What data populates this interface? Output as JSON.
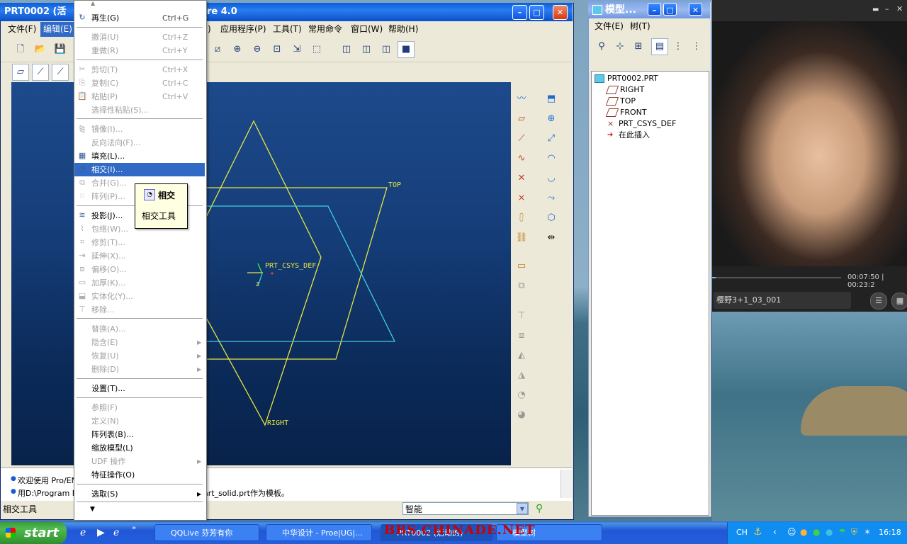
{
  "main_window": {
    "title": "PRT0002 (活",
    "title_suffix": "re 4.0",
    "menus": [
      "文件(F)",
      "编辑(E)",
      "应用程序(P)",
      "工具(T)",
      "常用命令",
      "窗口(W)",
      "帮助(H)"
    ],
    "menu_partial": ")"
  },
  "viewport": {
    "labels": {
      "top": "TOP",
      "right": "RIGHT",
      "csys": "PRT_CSYS_DEF",
      "z": "Z"
    }
  },
  "edit_menu": {
    "items": [
      {
        "label": "再生(G)",
        "shortcut": "Ctrl+G",
        "disabled": false,
        "icon": "regenerate-icon"
      },
      {
        "label": "撤消(U)",
        "shortcut": "Ctrl+Z",
        "disabled": true
      },
      {
        "label": "重做(R)",
        "shortcut": "Ctrl+Y",
        "disabled": true
      },
      {
        "label": "剪切(T)",
        "shortcut": "Ctrl+X",
        "disabled": true,
        "icon": "cut-icon"
      },
      {
        "label": "复制(C)",
        "shortcut": "Ctrl+C",
        "disabled": true,
        "icon": "copy-icon"
      },
      {
        "label": "粘贴(P)",
        "shortcut": "Ctrl+V",
        "disabled": true,
        "icon": "paste-icon"
      },
      {
        "label": "选择性粘贴(S)...",
        "shortcut": "",
        "disabled": true
      },
      {
        "label": "镜像(I)...",
        "shortcut": "",
        "disabled": true,
        "icon": "mirror-icon"
      },
      {
        "label": "反向法向(F)...",
        "shortcut": "",
        "disabled": true
      },
      {
        "label": "填充(L)...",
        "shortcut": "",
        "disabled": false,
        "icon": "fill-icon"
      },
      {
        "label": "相交(I)...",
        "shortcut": "",
        "disabled": false,
        "highlighted": true,
        "icon": "intersect-icon"
      },
      {
        "label": "合并(G)...",
        "shortcut": "",
        "disabled": true,
        "icon": "merge-icon"
      },
      {
        "label": "阵列(P)...",
        "shortcut": "",
        "disabled": true,
        "icon": "pattern-icon"
      },
      {
        "label": "投影(J)...",
        "shortcut": "",
        "disabled": false,
        "icon": "project-icon"
      },
      {
        "label": "包络(W)...",
        "shortcut": "",
        "disabled": true,
        "icon": "wrap-icon"
      },
      {
        "label": "修剪(T)...",
        "shortcut": "",
        "disabled": true,
        "icon": "trim-icon"
      },
      {
        "label": "延伸(X)...",
        "shortcut": "",
        "disabled": true,
        "icon": "extend-icon"
      },
      {
        "label": "偏移(O)...",
        "shortcut": "",
        "disabled": true,
        "icon": "offset-icon"
      },
      {
        "label": "加厚(K)...",
        "shortcut": "",
        "disabled": true,
        "icon": "thicken-icon"
      },
      {
        "label": "实体化(Y)...",
        "shortcut": "",
        "disabled": true,
        "icon": "solidify-icon"
      },
      {
        "label": "移除...",
        "shortcut": "",
        "disabled": true,
        "icon": "remove-icon"
      },
      {
        "label": "替换(A)...",
        "shortcut": "",
        "disabled": true
      },
      {
        "label": "隐含(E)",
        "shortcut": "",
        "disabled": true,
        "submenu": true
      },
      {
        "label": "恢复(U)",
        "shortcut": "",
        "disabled": true,
        "submenu": true
      },
      {
        "label": "删除(D)",
        "shortcut": "",
        "disabled": true,
        "submenu": true
      },
      {
        "label": "设置(T)...",
        "shortcut": "",
        "disabled": false
      },
      {
        "label": "参照(F)",
        "shortcut": "",
        "disabled": true
      },
      {
        "label": "定义(N)",
        "shortcut": "",
        "disabled": true
      },
      {
        "label": "阵列表(B)...",
        "shortcut": "",
        "disabled": false
      },
      {
        "label": "缩放模型(L)",
        "shortcut": "",
        "disabled": false
      },
      {
        "label": "UDF 操作",
        "shortcut": "",
        "disabled": true,
        "submenu": true
      },
      {
        "label": "特征操作(O)",
        "shortcut": "",
        "disabled": false
      },
      {
        "label": "选取(S)",
        "shortcut": "",
        "disabled": false,
        "submenu": true
      }
    ]
  },
  "tooltip": {
    "title": "相交",
    "body": "相交工具"
  },
  "messages": {
    "line1": "欢迎使用 Pro/EN",
    "line2": "用D:\\Program Fil",
    "line2_tail": "art_solid.prt作为模板。"
  },
  "status": {
    "left": "相交工具",
    "filter": "智能"
  },
  "model_tree": {
    "title": "模型...",
    "menus": [
      "文件(E)",
      "树(T)"
    ],
    "items": [
      {
        "label": "PRT0002.PRT",
        "icon": "part-icon",
        "level": 0
      },
      {
        "label": "RIGHT",
        "icon": "datum-plane-icon",
        "level": 1
      },
      {
        "label": "TOP",
        "icon": "datum-plane-icon",
        "level": 1
      },
      {
        "label": "FRONT",
        "icon": "datum-plane-icon",
        "level": 1
      },
      {
        "label": "PRT_CSYS_DEF",
        "icon": "csys-icon",
        "level": 1
      },
      {
        "label": "在此插入",
        "icon": "insert-arrow-icon",
        "level": 1
      }
    ]
  },
  "video": {
    "time": "00:07:50",
    "time2": "00:23:2",
    "title": "樱野3+1_03_001",
    "progress": 0.03
  },
  "taskbar": {
    "start": "start",
    "tasks": [
      "QQLive 芬芳有你",
      "中华设计 - Proe|UG|...",
      "PRT0002 (活动的)",
      "模型树"
    ],
    "tray_lang": "CH",
    "clock": "16:18",
    "watermark": "BBS.CHINADE.NET"
  }
}
